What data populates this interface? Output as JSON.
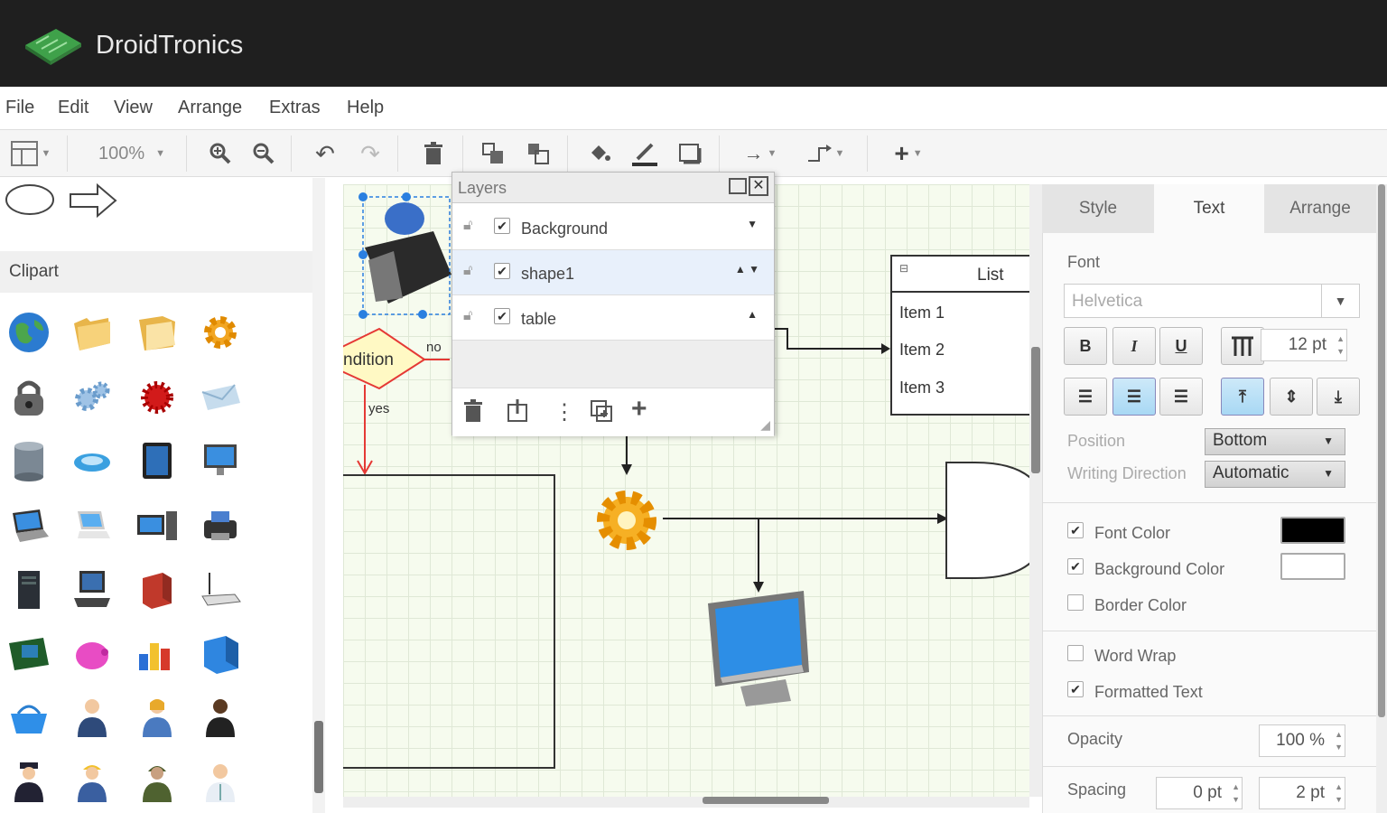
{
  "app": {
    "title": "DroidTronics"
  },
  "menu": [
    "File",
    "Edit",
    "View",
    "Arrange",
    "Extras",
    "Help"
  ],
  "toolbar": {
    "zoom": "100%"
  },
  "sidebar": {
    "clipart_header": "Clipart"
  },
  "layers": {
    "title": "Layers",
    "rows": [
      {
        "name": "Background",
        "checked": "✔",
        "arrows": "▼"
      },
      {
        "name": "shape1",
        "checked": "✔",
        "arrows": "▲ ▼"
      },
      {
        "name": "table",
        "checked": "✔",
        "arrows": "▲"
      }
    ]
  },
  "canvas": {
    "condition_label": "ndition",
    "no_label": "no",
    "yes_label": "yes",
    "list_title": "List",
    "list_items": [
      "Item 1",
      "Item 2",
      "Item 3"
    ]
  },
  "format_panel": {
    "tabs": [
      "Style",
      "Text",
      "Arrange"
    ],
    "active_tab": "Text",
    "font_label": "Font",
    "font_value": "Helvetica",
    "font_size": "12 pt",
    "bold": "B",
    "italic": "I",
    "underline": "U",
    "position_label": "Position",
    "position_value": "Bottom",
    "writing_direction_label": "Writing Direction",
    "writing_direction_value": "Automatic",
    "font_color_label": "Font Color",
    "background_color_label": "Background Color",
    "border_color_label": "Border Color",
    "word_wrap_label": "Word Wrap",
    "formatted_text_label": "Formatted Text",
    "opacity_label": "Opacity",
    "opacity_value": "100 %",
    "spacing_label": "Spacing",
    "spacing_top": "0 pt",
    "spacing_global": "2 pt",
    "check": "✔",
    "font_color": "#000000",
    "background_color": "#ffffff"
  },
  "colors": {
    "accent": "#a8d8f4",
    "titlebar": "#1f1f1f"
  }
}
